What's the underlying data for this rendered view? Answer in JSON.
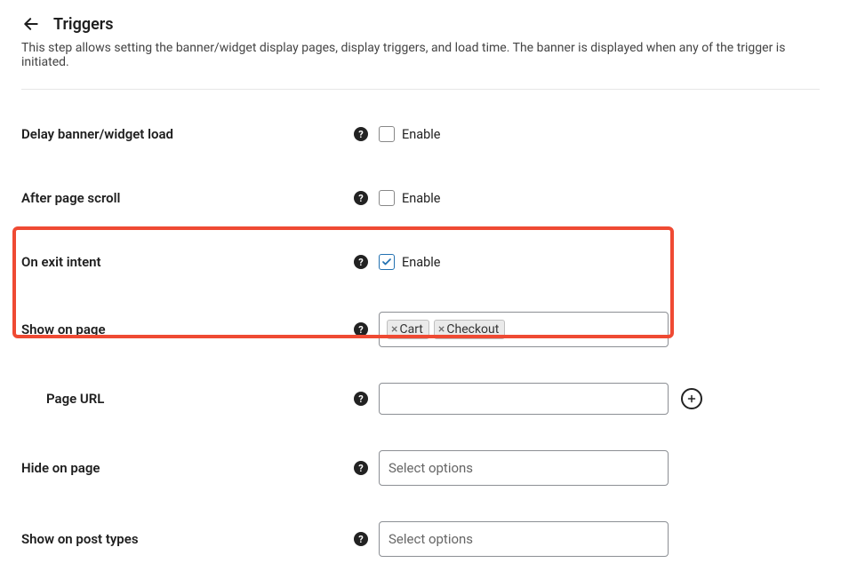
{
  "header": {
    "title": "Triggers",
    "description": "This step allows setting the banner/widget display pages, display triggers, and load time. The banner is displayed when any of the trigger is initiated."
  },
  "rows": {
    "delay_load": {
      "label": "Delay banner/widget load",
      "enable_label": "Enable",
      "checked": false
    },
    "after_scroll": {
      "label": "After page scroll",
      "enable_label": "Enable",
      "checked": false
    },
    "exit_intent": {
      "label": "On exit intent",
      "enable_label": "Enable",
      "checked": true
    },
    "show_on_page": {
      "label": "Show on page",
      "tags": [
        "Cart",
        "Checkout"
      ]
    },
    "page_url": {
      "label": "Page URL",
      "value": ""
    },
    "hide_on_page": {
      "label": "Hide on page",
      "placeholder": "Select options"
    },
    "show_on_post_types": {
      "label": "Show on post types",
      "placeholder": "Select options"
    }
  }
}
